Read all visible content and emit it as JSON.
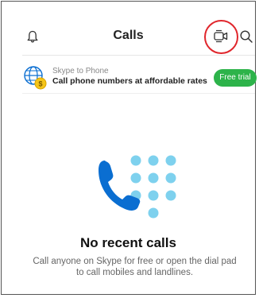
{
  "header": {
    "title": "Calls",
    "icons": {
      "left": "bell-icon",
      "right": [
        "video-call-icon",
        "search-icon"
      ]
    },
    "highlight_color": "#e0262c"
  },
  "promo": {
    "title": "Skype to Phone",
    "subtitle": "Call phone numbers at affordable rates",
    "button_label": "Free trial",
    "icon": "globe-coin-icon",
    "button_color": "#2db34a"
  },
  "empty_state": {
    "title": "No recent calls",
    "description": "Call anyone on Skype for free or open the dial pad to call mobiles and landlines.",
    "illustration": "phone-dialpad-icon",
    "accent_color": "#0a6ed1",
    "dot_color": "#7ed1ee"
  }
}
